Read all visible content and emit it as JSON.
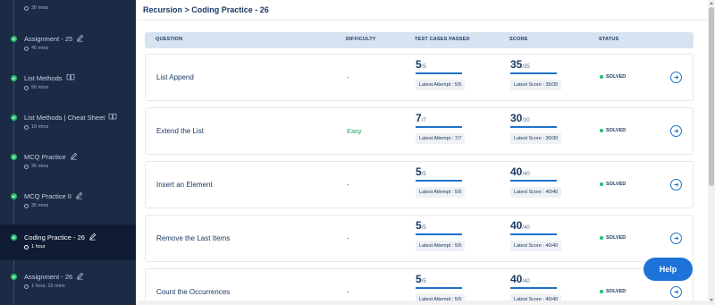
{
  "sidebar": {
    "items": [
      {
        "title": "",
        "duration": "30 mins",
        "icon": "",
        "active": false
      },
      {
        "title": "Assignment - 25",
        "duration": "45 mins",
        "icon": "pencil-icon",
        "active": false
      },
      {
        "title": "List Methods",
        "duration": "50 mins",
        "icon": "book-icon",
        "active": false
      },
      {
        "title": "List Methods | Cheat Sheet",
        "duration": "10 mins",
        "icon": "book-icon",
        "active": false
      },
      {
        "title": "MCQ Practice",
        "duration": "30 mins",
        "icon": "pencil-icon",
        "active": false
      },
      {
        "title": "MCQ Practice II",
        "duration": "35 mins",
        "icon": "pencil-icon",
        "active": false
      },
      {
        "title": "Coding Practice - 26",
        "duration": "1 hour",
        "icon": "pencil-icon",
        "active": true
      },
      {
        "title": "Assignment - 26",
        "duration": "1 hour, 15 mins",
        "icon": "pencil-icon",
        "active": false
      }
    ]
  },
  "breadcrumb": "Recursion > Coding Practice - 26",
  "table": {
    "headers": {
      "question": "QUESTION",
      "difficulty": "DIFFICULTY",
      "test_cases": "TEST CASES PASSED",
      "score": "SCORE",
      "status": "STATUS"
    },
    "rows": [
      {
        "question": "List Append",
        "difficulty": "-",
        "tc_passed": "5",
        "tc_total": "/5",
        "tc_label": "Latest Attempt : 5/5",
        "score": "35",
        "score_total": "/35",
        "score_label": "Latest Score : 35/35",
        "status": "SOLVED"
      },
      {
        "question": "Extend the List",
        "difficulty": "Easy",
        "tc_passed": "7",
        "tc_total": "/7",
        "tc_label": "Latest Attempt : 7/7",
        "score": "30",
        "score_total": "/30",
        "score_label": "Latest Score : 30/30",
        "status": "SOLVED"
      },
      {
        "question": "Insert an Element",
        "difficulty": "-",
        "tc_passed": "5",
        "tc_total": "/5",
        "tc_label": "Latest Attempt : 5/5",
        "score": "40",
        "score_total": "/40",
        "score_label": "Latest Score : 40/40",
        "status": "SOLVED"
      },
      {
        "question": "Remove the Last Items",
        "difficulty": "-",
        "tc_passed": "5",
        "tc_total": "/5",
        "tc_label": "Latest Attempt : 5/5",
        "score": "40",
        "score_total": "/40",
        "score_label": "Latest Score : 40/40",
        "status": "SOLVED"
      },
      {
        "question": "Count the Occurrences",
        "difficulty": "-",
        "tc_passed": "5",
        "tc_total": "/5",
        "tc_label": "Latest Attempt : 5/5",
        "score": "40",
        "score_total": "/40",
        "score_label": "Latest Score : 40/40",
        "status": "SOLVED"
      }
    ]
  },
  "help_label": "Help",
  "colors": {
    "sidebar_bg": "#1b2a45",
    "accent": "#1e73c8",
    "success": "#1fbf6a",
    "easy": "#1fa35a"
  }
}
